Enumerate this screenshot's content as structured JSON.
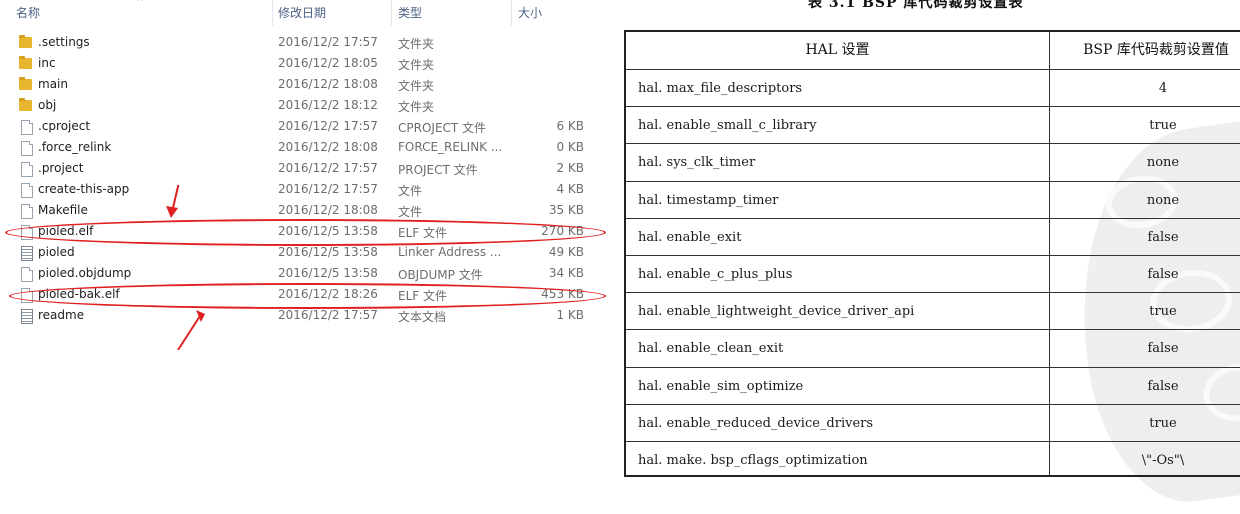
{
  "explorer": {
    "columns": {
      "name": "名称",
      "date": "修改日期",
      "type": "类型",
      "size": "大小"
    },
    "files": [
      {
        "name": ".settings",
        "date": "2016/12/2 17:57",
        "type": "文件夹",
        "size": "",
        "icon": "folder-icon"
      },
      {
        "name": "inc",
        "date": "2016/12/2 18:05",
        "type": "文件夹",
        "size": "",
        "icon": "folder-icon"
      },
      {
        "name": "main",
        "date": "2016/12/2 18:08",
        "type": "文件夹",
        "size": "",
        "icon": "folder-icon"
      },
      {
        "name": "obj",
        "date": "2016/12/2 18:12",
        "type": "文件夹",
        "size": "",
        "icon": "folder-icon"
      },
      {
        "name": ".cproject",
        "date": "2016/12/2 17:57",
        "type": "CPROJECT 文件",
        "size": "6 KB",
        "icon": "file-icon"
      },
      {
        "name": ".force_relink",
        "date": "2016/12/2 18:08",
        "type": "FORCE_RELINK ...",
        "size": "0 KB",
        "icon": "file-icon"
      },
      {
        "name": ".project",
        "date": "2016/12/2 17:57",
        "type": "PROJECT 文件",
        "size": "2 KB",
        "icon": "file-icon"
      },
      {
        "name": "create-this-app",
        "date": "2016/12/2 17:57",
        "type": "文件",
        "size": "4 KB",
        "icon": "file-icon"
      },
      {
        "name": "Makefile",
        "date": "2016/12/2 18:08",
        "type": "文件",
        "size": "35 KB",
        "icon": "file-icon"
      },
      {
        "name": "pioled.elf",
        "date": "2016/12/5 13:58",
        "type": "ELF 文件",
        "size": "270 KB",
        "icon": "file-icon"
      },
      {
        "name": "pioled",
        "date": "2016/12/5 13:58",
        "type": "Linker Address ...",
        "size": "49 KB",
        "icon": "text-icon"
      },
      {
        "name": "pioled.objdump",
        "date": "2016/12/5 13:58",
        "type": "OBJDUMP 文件",
        "size": "34 KB",
        "icon": "file-icon"
      },
      {
        "name": "pioled-bak.elf",
        "date": "2016/12/2 18:26",
        "type": "ELF 文件",
        "size": "453 KB",
        "icon": "file-icon"
      },
      {
        "name": "readme",
        "date": "2016/12/2 17:57",
        "type": "文本文档",
        "size": "1 KB",
        "icon": "text-icon"
      }
    ]
  },
  "book": {
    "caption": "表 3.1   BSP 库代码裁剪设置表",
    "headers": {
      "setting": "HAL 设置",
      "value": "BSP 库代码裁剪设置值"
    },
    "rows": [
      {
        "setting": "hal. max_file_descriptors",
        "value": "4"
      },
      {
        "setting": "hal. enable_small_c_library",
        "value": "true"
      },
      {
        "setting": "hal. sys_clk_timer",
        "value": "none"
      },
      {
        "setting": "hal. timestamp_timer",
        "value": "none"
      },
      {
        "setting": "hal. enable_exit",
        "value": "false"
      },
      {
        "setting": "hal. enable_c_plus_plus",
        "value": "false"
      },
      {
        "setting": "hal. enable_lightweight_device_driver_api",
        "value": "true"
      },
      {
        "setting": "hal. enable_clean_exit",
        "value": "false"
      },
      {
        "setting": "hal. enable_sim_optimize",
        "value": "false"
      },
      {
        "setting": "hal. enable_reduced_device_drivers",
        "value": "true"
      },
      {
        "setting": "hal. make. bsp_cflags_optimization",
        "value": "\\\"-Os\"\\"
      }
    ]
  },
  "colors": {
    "highlight": "#e02020",
    "header_text": "#4d6185",
    "folder": "#e8b531"
  }
}
